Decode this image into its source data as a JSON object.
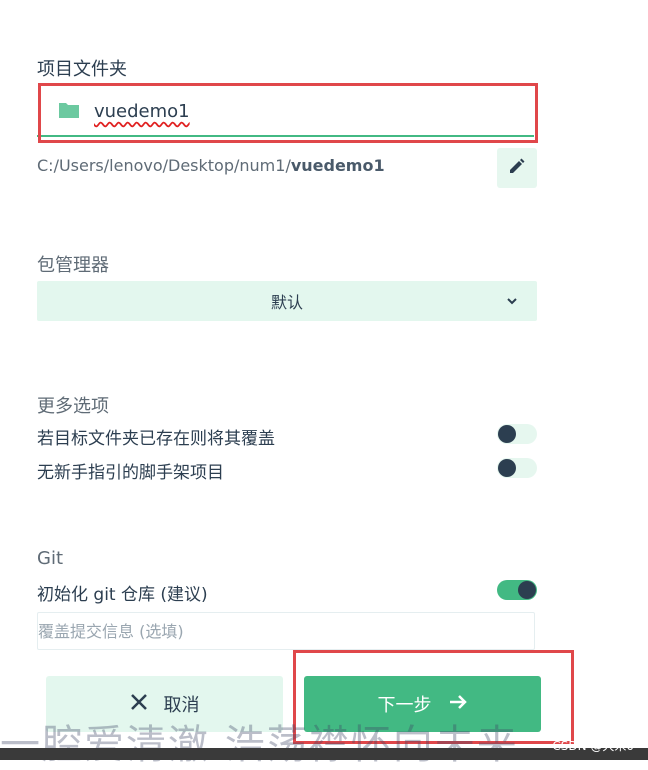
{
  "folder": {
    "label": "项目文件夹",
    "value": "vuedemo1",
    "path_prefix": "C:/Users/lenovo/Desktop/num1/",
    "path_name": "vuedemo1",
    "folder_icon": "folder-icon",
    "edit_icon": "pencil-icon"
  },
  "package_manager": {
    "label": "包管理器",
    "selected": "默认",
    "chevron_icon": "chevron-down-icon"
  },
  "more_options": {
    "label": "更多选项",
    "items": [
      {
        "label": "若目标文件夹已存在则将其覆盖",
        "enabled": false
      },
      {
        "label": "无新手指引的脚手架项目",
        "enabled": false
      }
    ]
  },
  "git": {
    "label": "Git",
    "init_label": "初始化 git 仓库 (建议)",
    "init_enabled": true,
    "commit_placeholder": "覆盖提交信息 (选填)"
  },
  "buttons": {
    "cancel_label": "取消",
    "cancel_icon": "close-icon",
    "next_label": "下一步",
    "next_icon": "arrow-right-icon"
  },
  "overlay": {
    "watermark": "一腔爱清澈 浩荡襟怀向未来",
    "csdn_credit": "CSDN @大米0"
  },
  "colors": {
    "accent": "#42b983",
    "light_accent": "#e3f7ee",
    "text": "#2c3e50",
    "highlight_box": "#e0474a"
  }
}
